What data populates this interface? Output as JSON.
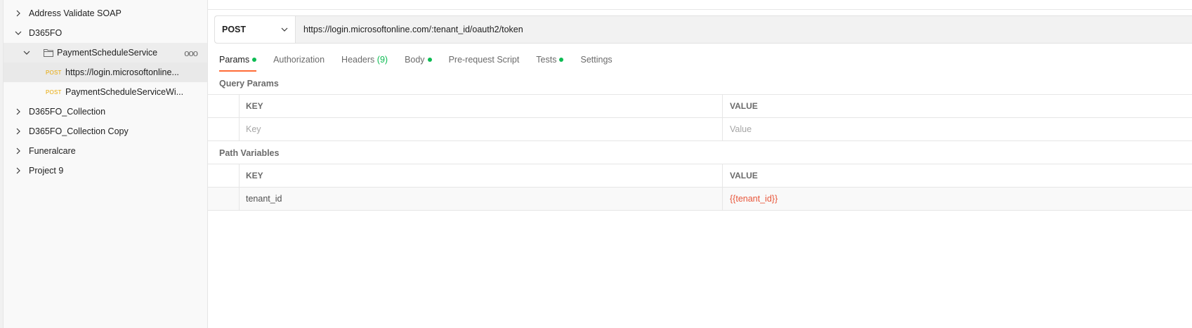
{
  "sidebar": {
    "items": [
      {
        "label": "Address Validate SOAP",
        "expanded": false
      },
      {
        "label": "D365FO",
        "expanded": true
      },
      {
        "label": "PaymentScheduleService",
        "expanded": true,
        "icon": "folder-icon",
        "more": "ooo"
      },
      {
        "method": "POST",
        "label": "https://login.microsoftonline..."
      },
      {
        "method": "POST",
        "label": "PaymentScheduleServiceWi..."
      },
      {
        "label": "D365FO_Collection",
        "expanded": false
      },
      {
        "label": "D365FO_Collection Copy",
        "expanded": false
      },
      {
        "label": "Funeralcare",
        "expanded": false
      },
      {
        "label": "Project 9",
        "expanded": false
      }
    ]
  },
  "request": {
    "method": "POST",
    "url": "https://login.microsoftonline.com/:tenant_id/oauth2/token"
  },
  "tabs": {
    "params": "Params",
    "authorization": "Authorization",
    "headers": "Headers",
    "headers_count": "(9)",
    "body": "Body",
    "prerequest": "Pre-request Script",
    "tests": "Tests",
    "settings": "Settings"
  },
  "query_params": {
    "title": "Query Params",
    "key_header": "KEY",
    "value_header": "VALUE",
    "key_placeholder": "Key",
    "value_placeholder": "Value"
  },
  "path_variables": {
    "title": "Path Variables",
    "key_header": "KEY",
    "value_header": "VALUE",
    "rows": [
      {
        "key": "tenant_id",
        "value": "{{tenant_id}}"
      }
    ]
  },
  "colors": {
    "accent": "#ff6c37",
    "dot": "#0cbb52",
    "post": "#e8a700",
    "variable": "#e8563a"
  }
}
